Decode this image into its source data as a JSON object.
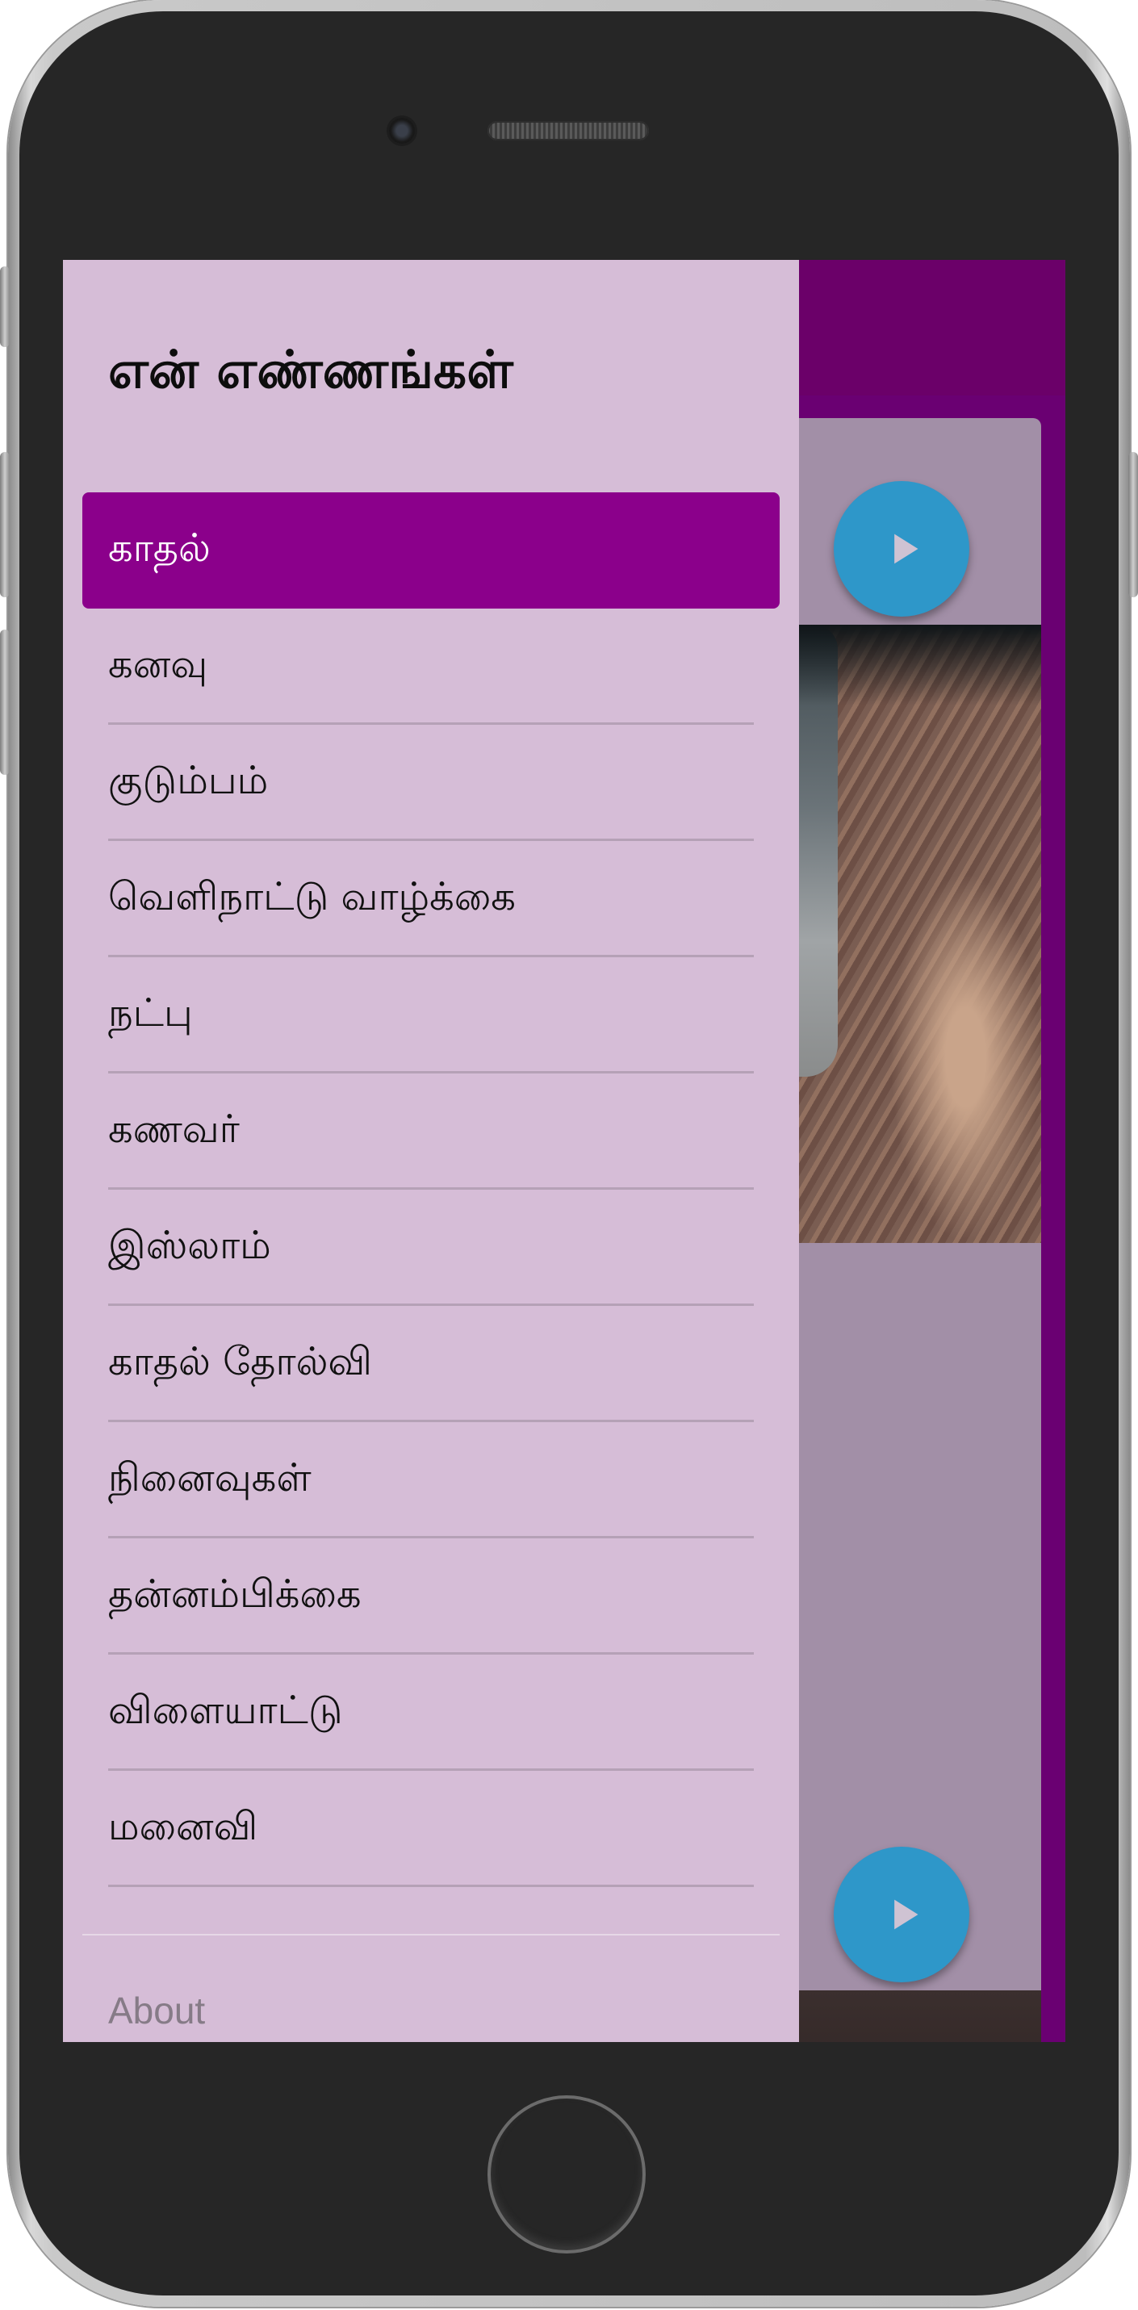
{
  "drawer": {
    "title": "என் எண்ணங்கள்",
    "items": [
      {
        "label": "காதல்",
        "active": true
      },
      {
        "label": "கனவு"
      },
      {
        "label": "குடும்பம்"
      },
      {
        "label": "வெளிநாட்டு வாழ்க்கை"
      },
      {
        "label": "நட்பு"
      },
      {
        "label": "கணவர்"
      },
      {
        "label": "இஸ்லாம்"
      },
      {
        "label": "காதல் தோல்வி"
      },
      {
        "label": "நினைவுகள்"
      },
      {
        "label": "தன்னம்பிக்கை"
      },
      {
        "label": "விளையாட்டு"
      },
      {
        "label": "மனைவி"
      }
    ],
    "about_label": "About"
  },
  "colors": {
    "drawer_background": "#d6bdd7",
    "active_item": "#8b008b",
    "toolbar": "#6b0069",
    "play_button": "#2e97c9"
  },
  "icons": {
    "play": "play-icon"
  }
}
